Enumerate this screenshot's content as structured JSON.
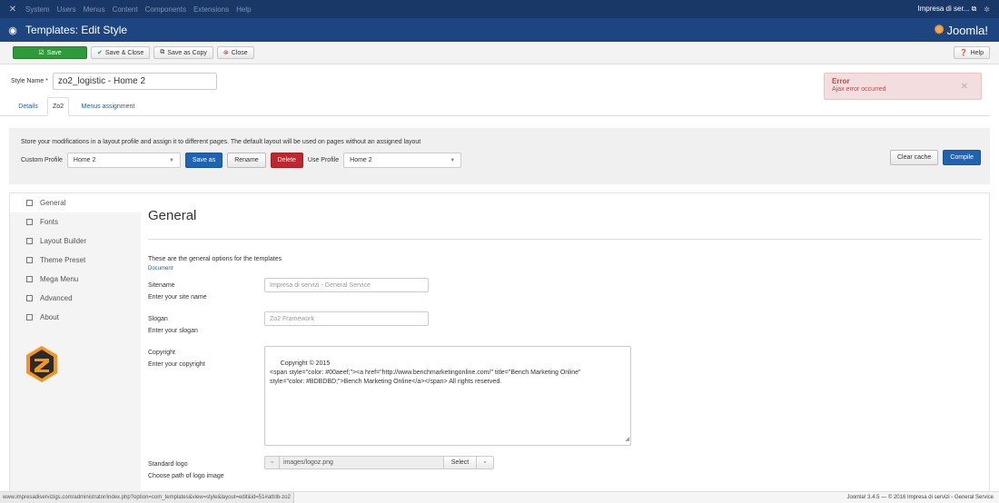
{
  "topbar": {
    "menu": [
      "System",
      "Users",
      "Menus",
      "Content",
      "Components",
      "Extensions",
      "Help"
    ],
    "site_link": "Impresa di ser..."
  },
  "header": {
    "title": "Templates: Edit Style",
    "brand": "Joomla!"
  },
  "toolbar": {
    "save": "Save",
    "save_close": "Save & Close",
    "save_copy": "Save as Copy",
    "close": "Close",
    "help": "Help"
  },
  "style": {
    "label": "Style Name *",
    "value": "zo2_logistic - Home 2"
  },
  "alert": {
    "title": "Error",
    "message": "Ajax error occurred"
  },
  "tabs": [
    "Details",
    "Zo2",
    "Menus assignment"
  ],
  "profile": {
    "description": "Store your modifications in a layout profile and assign it to different pages. The default layout will be used on pages without an assigned layout",
    "custom_label": "Custom Profile",
    "custom_value": "Home 2",
    "save_as": "Save as",
    "rename": "Rename",
    "delete": "Delete",
    "use_label": "Use Profile",
    "use_value": "Home 2",
    "clear_cache": "Clear cache",
    "compile": "Compile"
  },
  "sidebar": {
    "items": [
      "General",
      "Fonts",
      "Layout Builder",
      "Theme Preset",
      "Mega Menu",
      "Advanced",
      "About"
    ]
  },
  "general": {
    "heading": "General",
    "intro": "These are the general options for the templates",
    "doc_link": "Document",
    "sitename_label": "Sitename",
    "sitename_help": "Enter your site name",
    "sitename_value": "Impresa di servizi - General Service",
    "slogan_label": "Slogan",
    "slogan_help": "Enter your slogan",
    "slogan_value": "Zo2 Framework",
    "copyright_label": "Copyright",
    "copyright_help": "Enter your copyright",
    "copyright_value": "Copyright © 2015\n<span style=\"color: #00aeef;\"><a href=\"http://www.benchmarketingonline.com/\" title=\"Bench Marketing Online\"\nstyle=\"color: #BDBDBD;\">Bench Marketing Online</a></span> All rights reserved.",
    "logo_label": "Standard logo",
    "logo_help": "Choose path of logo image",
    "logo_value": "images/logoz.png",
    "logo_select": "Select"
  },
  "statusbar": {
    "url": "www.impresadiservizigs.com/administrator/index.php?option=com_templates&view=style&layout=edit&id=51#attrib-zo2",
    "version": "Joomla! 3.4.5 — © 2016 Impresa di servizi - General Service"
  },
  "colors": {
    "topbar": "#1a3867",
    "header": "#1d4580",
    "save_green": "#2f9a3a",
    "primary_blue": "#1f63b4",
    "danger_red": "#c0262d",
    "error_bg": "#f2dede",
    "zo2_orange": "#f7941d"
  }
}
